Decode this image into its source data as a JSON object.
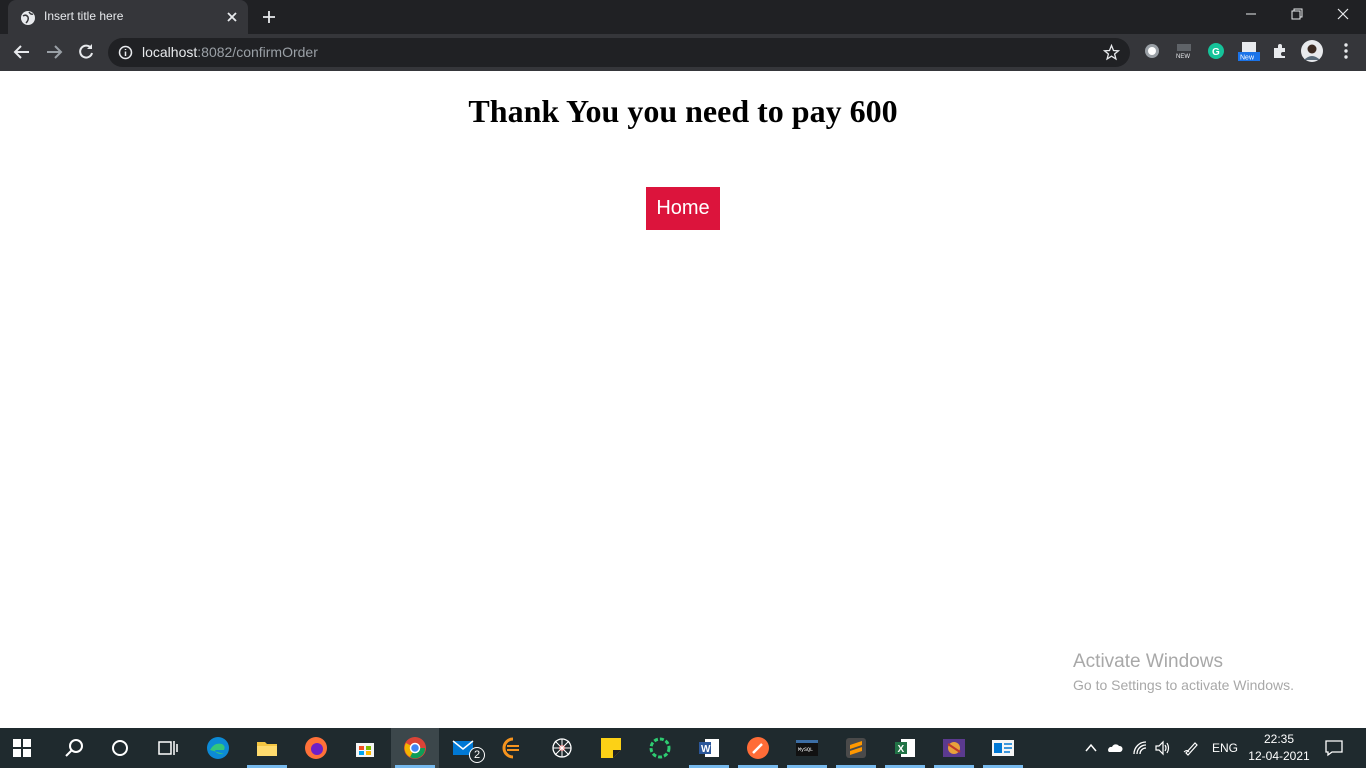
{
  "browser": {
    "tab_title": "Insert title here",
    "url_host": "localhost",
    "url_rest": ":8082/confirmOrder"
  },
  "page": {
    "heading": "Thank You you need to pay 600",
    "home_label": "Home"
  },
  "watermark": {
    "title": "Activate Windows",
    "subtitle": "Go to Settings to activate Windows."
  },
  "taskbar": {
    "mail_badge": "2",
    "language": "ENG",
    "time": "22:35",
    "date": "12-04-2021"
  },
  "colors": {
    "home_button": "#dc143c",
    "browser_dark": "#202124",
    "browser_toolbar": "#35363a",
    "taskbar": "#1f2a2e"
  }
}
